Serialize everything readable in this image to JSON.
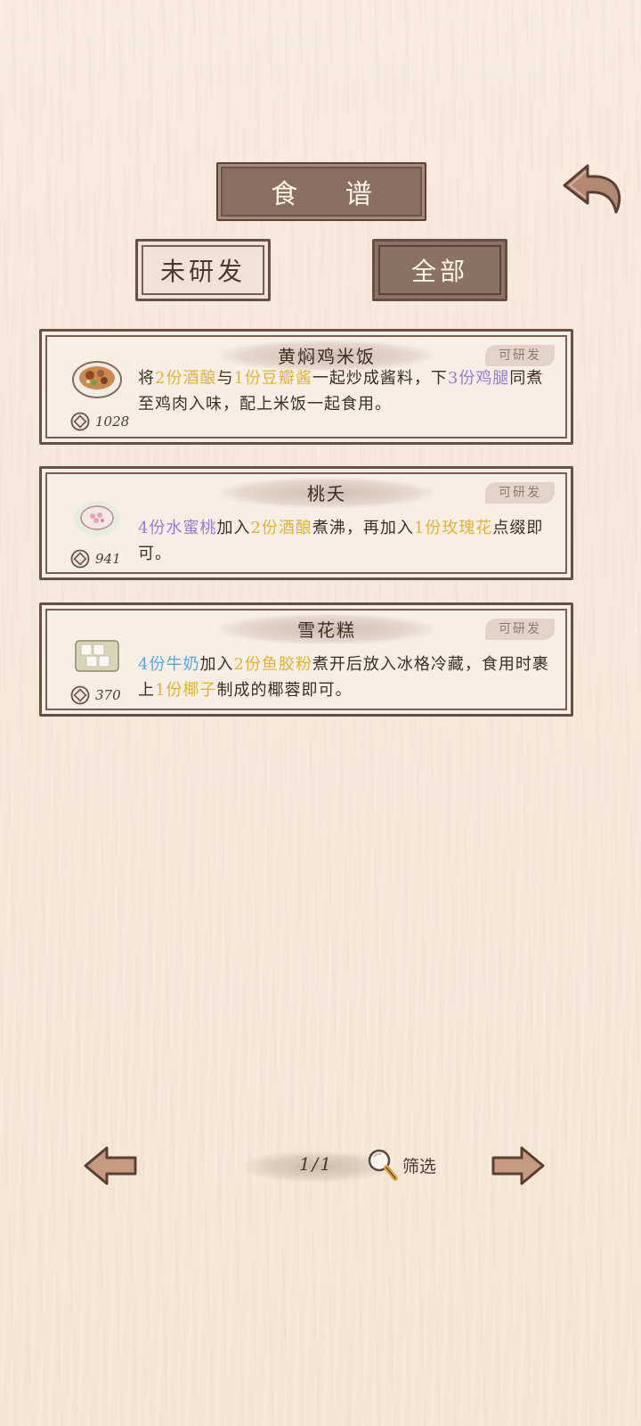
{
  "header": {
    "title": "食 谱",
    "back_icon": "curved-back-arrow-icon"
  },
  "tabs": [
    {
      "label": "未研发",
      "active": false
    },
    {
      "label": "全部",
      "active": true
    }
  ],
  "recipes": [
    {
      "name": "黄焖鸡米饭",
      "badge": "可研发",
      "price": "1028",
      "icon": "braised-chicken-rice-bowl-icon",
      "segments": [
        {
          "text": "将",
          "color": "normal"
        },
        {
          "text": "2份酒酿",
          "color": "yellow"
        },
        {
          "text": "与",
          "color": "normal"
        },
        {
          "text": "1份豆瓣酱",
          "color": "yellow"
        },
        {
          "text": "一起炒成酱料，下",
          "color": "normal"
        },
        {
          "text": "3份鸡腿",
          "color": "purple"
        },
        {
          "text": "同煮至鸡肉入味，配上米饭一起食用。",
          "color": "normal"
        }
      ]
    },
    {
      "name": "桃夭",
      "badge": "可研发",
      "price": "941",
      "icon": "peach-dessert-bowl-icon",
      "segments": [
        {
          "text": "4份水蜜桃",
          "color": "purple"
        },
        {
          "text": "加入",
          "color": "normal"
        },
        {
          "text": "2份酒酿",
          "color": "yellow"
        },
        {
          "text": "煮沸，再加入",
          "color": "normal"
        },
        {
          "text": "1份玫瑰花",
          "color": "yellow"
        },
        {
          "text": "点缀即可。",
          "color": "normal"
        }
      ]
    },
    {
      "name": "雪花糕",
      "badge": "可研发",
      "price": "370",
      "icon": "snowflake-cake-plate-icon",
      "segments": [
        {
          "text": "4份牛奶",
          "color": "blue"
        },
        {
          "text": "加入",
          "color": "normal"
        },
        {
          "text": "2份鱼胶粉",
          "color": "yellow"
        },
        {
          "text": "煮开后放入冰格冷藏，食用时裹上",
          "color": "normal"
        },
        {
          "text": "1份椰子",
          "color": "yellow"
        },
        {
          "text": "制成的椰蓉即可。",
          "color": "normal"
        }
      ]
    }
  ],
  "footer": {
    "page": "1/1",
    "filter_label": "筛选",
    "prev_icon": "left-arrow-icon",
    "next_icon": "right-arrow-icon",
    "filter_icon": "magnifier-icon"
  },
  "colors": {
    "yellow": "#e3b338",
    "purple": "#9a7ad8",
    "blue": "#55a6e6",
    "frame": "#6a4f44",
    "plate": "#8a6f60"
  }
}
